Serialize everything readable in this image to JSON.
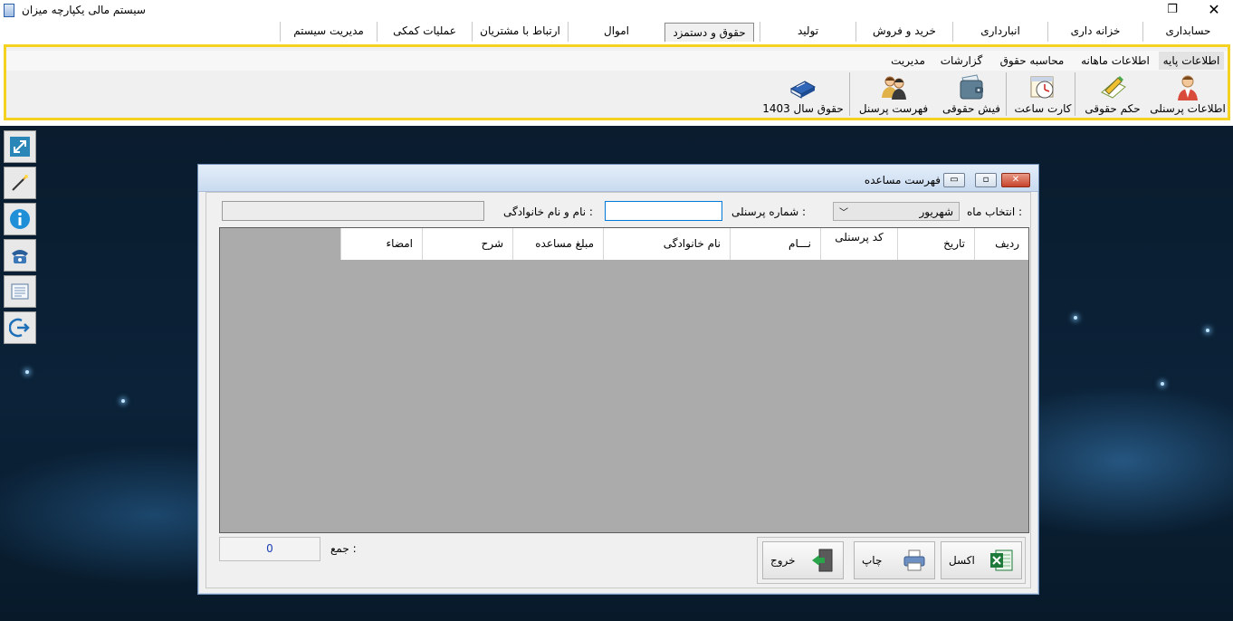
{
  "window": {
    "title": "سیستم مالی یکپارچه میزان",
    "restore_glyph": "❐",
    "close_glyph": "✕"
  },
  "main_menu": [
    {
      "label": "حسابداری"
    },
    {
      "label": "خزانه داری"
    },
    {
      "label": "انبارداری"
    },
    {
      "label": "خرید و فروش"
    },
    {
      "label": "تولید"
    },
    {
      "label": "حقوق و دستمزد",
      "active": true
    },
    {
      "label": "اموال"
    },
    {
      "label": "ارتباط با مشتریان"
    },
    {
      "label": "عملیات کمکی"
    },
    {
      "label": "مدیریت سیستم"
    }
  ],
  "ribbon": {
    "subtabs": [
      {
        "label": "اطلاعات پایه",
        "active": true
      },
      {
        "label": "اطلاعات ماهانه"
      },
      {
        "label": "محاسبه حقوق"
      },
      {
        "label": "گزارشات"
      },
      {
        "label": "مدیریت"
      }
    ],
    "tools": [
      {
        "label": "اطلاعات پرسنلی",
        "icon": "employee-icon"
      },
      {
        "label": "حکم حقوقی",
        "icon": "decree-icon"
      },
      {
        "label": "کارت ساعت",
        "icon": "time-card-icon"
      },
      {
        "label": "فیش حقوقی",
        "icon": "payslip-wallet-icon"
      },
      {
        "label": "فهرست پرسنل",
        "icon": "personnel-list-icon"
      },
      {
        "label": "حقوق سال 1403",
        "icon": "yearly-salary-book-icon"
      }
    ]
  },
  "sidebar": [
    {
      "icon": "resize-arrow-icon"
    },
    {
      "icon": "magic-wand-icon"
    },
    {
      "icon": "info-icon"
    },
    {
      "icon": "phone-icon"
    },
    {
      "icon": "notes-icon"
    },
    {
      "icon": "logout-icon"
    }
  ],
  "dialog": {
    "title": "فهرست مساعده",
    "month_label": "انتخاب ماه :",
    "month_value": "شهریور",
    "personnel_no_label": "شماره پرسنلی :",
    "personnel_no_value": "",
    "fullname_label": "نام و نام خانوادگی :",
    "fullname_value": "",
    "columns": [
      "ردیف",
      "تاریخ",
      "کد پرسنلی",
      "نـــام",
      "نام خانوادگی",
      "مبلغ مساعده",
      "شرح",
      "امضاء"
    ],
    "rows": [],
    "sum_label": "جمع :",
    "sum_value": "0",
    "buttons": {
      "excel": "اکسل",
      "print": "چاپ",
      "exit": "خروج"
    }
  },
  "colors": {
    "ribbon_border": "#f4d21f",
    "grid_background": "#ababab",
    "desktop_background": "#0b2238",
    "sum_text": "#1b3cb3"
  }
}
